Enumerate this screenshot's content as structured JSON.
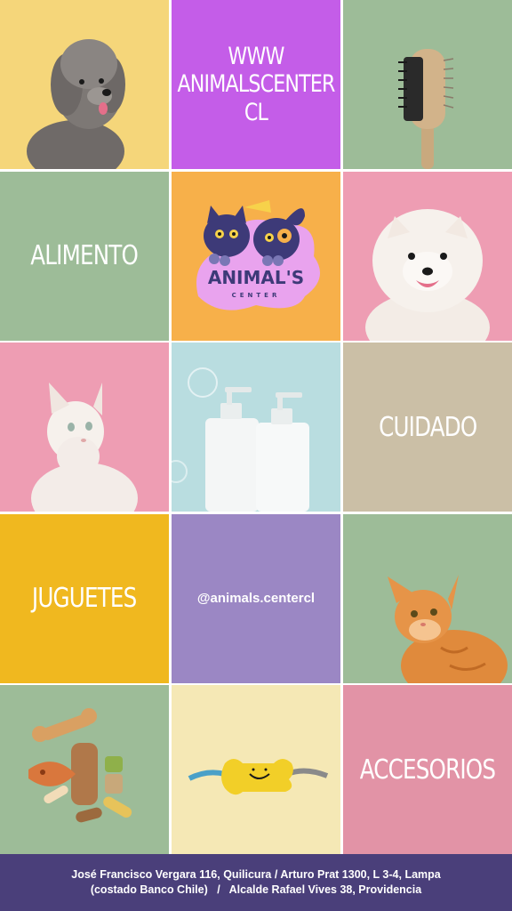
{
  "website": {
    "line1": "WWW",
    "line2": "ANIMALSCENTER",
    "line3": "CL"
  },
  "categories": {
    "alimento": "ALIMENTO",
    "cuidado": "CUIDADO",
    "juguetes": "JUGUETES",
    "accesorios": "ACCESORIOS"
  },
  "instagram": "@animals.centercl",
  "logo": {
    "line1": "ANIMAL'S",
    "line2": "CENTER"
  },
  "footer": {
    "line1": "José Francisco Vergara 116, Quilicura / Arturo Prat 1300, L 3-4, Lampa",
    "line2": "(costado Banco Chile)   /   Alcalde Rafael Vives 38, Providencia"
  },
  "colors": {
    "yellow": "#f5d67a",
    "purple": "#c45de8",
    "sage": "#9dbc98",
    "orange": "#f7b04a",
    "pink": "#ee9db3",
    "light_blue": "#b9dde0",
    "beige": "#cbbfa6",
    "mustard": "#f0b81f",
    "lavender": "#9b87c4",
    "cream": "#f5e8b5",
    "rose": "#e293a6",
    "footer": "#4a3f7a"
  }
}
